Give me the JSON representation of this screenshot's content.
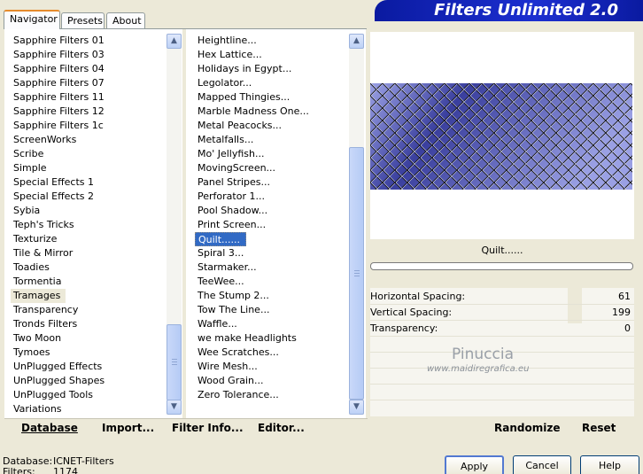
{
  "tabs": [
    "Navigator",
    "Presets",
    "About"
  ],
  "banner_title": "Filters Unlimited 2.0",
  "categories": [
    "Sapphire Filters 01",
    "Sapphire Filters 03",
    "Sapphire Filters 04",
    "Sapphire Filters 07",
    "Sapphire Filters 11",
    "Sapphire Filters 12",
    "Sapphire Filters 1c",
    "ScreenWorks",
    "Scribe",
    "Simple",
    "Special Effects 1",
    "Special Effects 2",
    "Sybia",
    "Teph's Tricks",
    "Texturize",
    "Tile & Mirror",
    "Toadies",
    "Tormentia",
    "Tramages",
    "Transparency",
    "Tronds Filters",
    "Two Moon",
    "Tymoes",
    "UnPlugged Effects",
    "UnPlugged Shapes",
    "UnPlugged Tools",
    "Variations"
  ],
  "selected_category": "Tramages",
  "filters": [
    "Heightline...",
    "Hex Lattice...",
    "Holidays in Egypt...",
    "Legolator...",
    "Mapped Thingies...",
    "Marble Madness One...",
    "Metal Peacocks...",
    "Metalfalls...",
    "Mo' Jellyfish...",
    "MovingScreen...",
    "Panel Stripes...",
    "Perforator 1...",
    "Pool Shadow...",
    "Print Screen...",
    "Quilt......",
    "Spiral 3...",
    "Starmaker...",
    "TeeWee...",
    "The Stump 2...",
    "Tow The Line...",
    "Waffle...",
    "we make Headlights",
    "Wee Scratches...",
    "Wire Mesh...",
    "Wood Grain...",
    "Zero Tolerance..."
  ],
  "selected_filter": "Quilt......",
  "filter_name": "Quilt......",
  "params": [
    {
      "label": "Horizontal Spacing:",
      "value": "61"
    },
    {
      "label": "Vertical Spacing:",
      "value": "199"
    },
    {
      "label": "Transparency:",
      "value": "0"
    }
  ],
  "watermark": {
    "name": "Pinuccia",
    "url": "www.maidiregrafica.eu"
  },
  "bottom_bar": {
    "database": "Database",
    "import": "Import...",
    "filter_info": "Filter Info...",
    "editor": "Editor...",
    "randomize": "Randomize",
    "reset": "Reset"
  },
  "status": {
    "database_label": "Database:",
    "database_value": "ICNET-Filters",
    "filters_label": "Filters:",
    "filters_value": "1174"
  },
  "buttons": {
    "apply": "Apply",
    "cancel": "Cancel",
    "help": "Help"
  },
  "colors": {
    "preview_dark": "#3a3f9e",
    "preview_light": "#9aa0e4",
    "selection": "#316ac5"
  }
}
